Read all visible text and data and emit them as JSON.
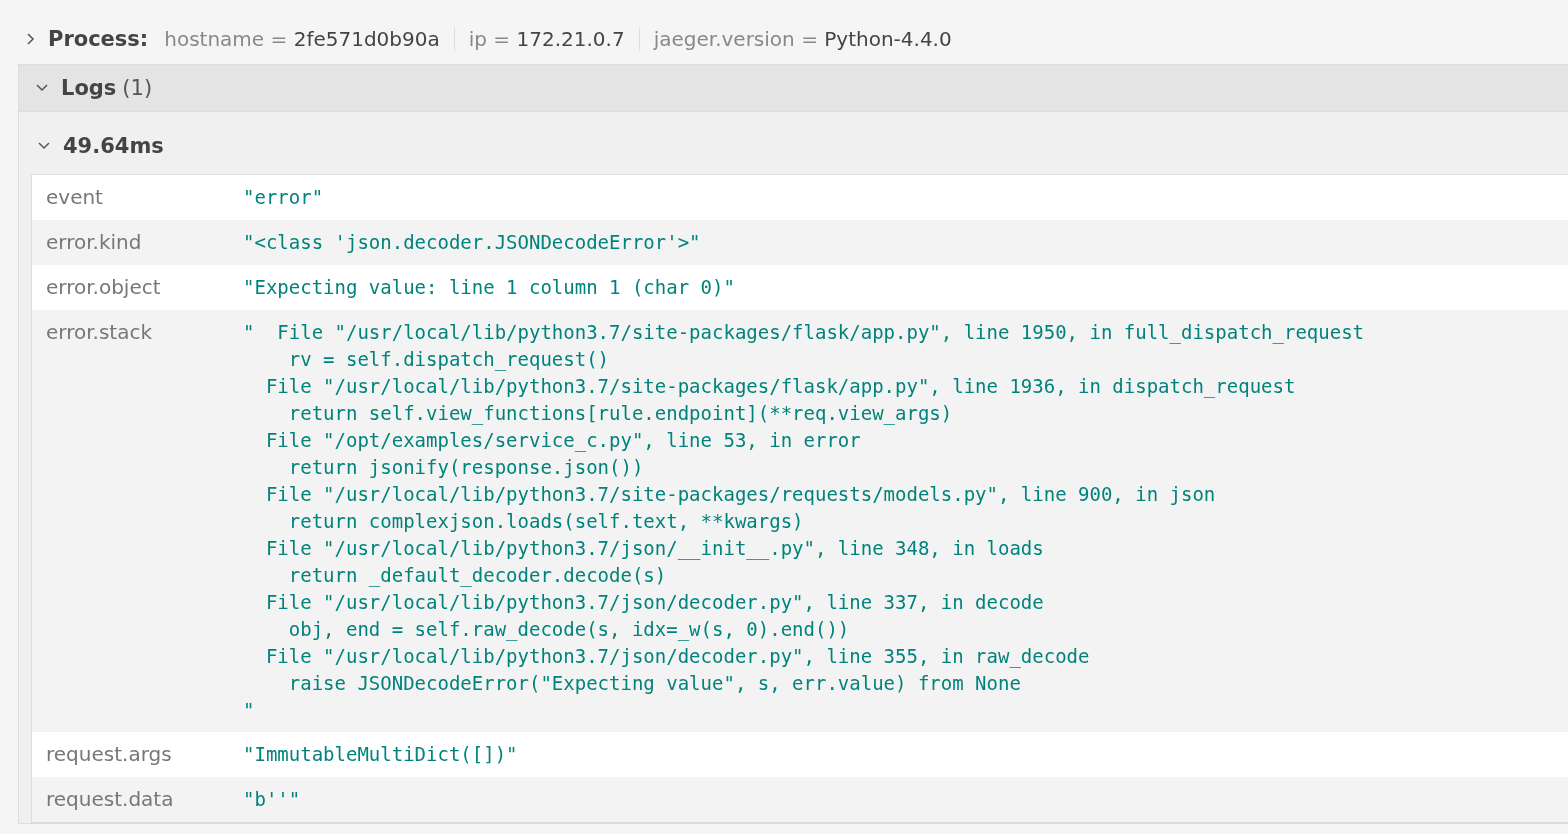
{
  "process": {
    "label": "Process:",
    "expanded": false,
    "tags": [
      {
        "key": "hostname",
        "sep": "=",
        "value": "2fe571d0b90a"
      },
      {
        "key": "ip",
        "sep": "=",
        "value": "172.21.0.7"
      },
      {
        "key": "jaeger.version",
        "sep": "=",
        "value": "Python-4.4.0"
      }
    ]
  },
  "logs": {
    "title": "Logs",
    "count": "(1)",
    "expanded": true,
    "entries": [
      {
        "time": "49.64ms",
        "expanded": true,
        "fields": [
          {
            "key": "event",
            "value": "\"error\""
          },
          {
            "key": "error.kind",
            "value": "\"<class 'json.decoder.JSONDecodeError'>\""
          },
          {
            "key": "error.object",
            "value": "\"Expecting value: line 1 column 1 (char 0)\""
          },
          {
            "key": "error.stack",
            "value": "\"  File \"/usr/local/lib/python3.7/site-packages/flask/app.py\", line 1950, in full_dispatch_request\n    rv = self.dispatch_request()\n  File \"/usr/local/lib/python3.7/site-packages/flask/app.py\", line 1936, in dispatch_request\n    return self.view_functions[rule.endpoint](**req.view_args)\n  File \"/opt/examples/service_c.py\", line 53, in error\n    return jsonify(response.json())\n  File \"/usr/local/lib/python3.7/site-packages/requests/models.py\", line 900, in json\n    return complexjson.loads(self.text, **kwargs)\n  File \"/usr/local/lib/python3.7/json/__init__.py\", line 348, in loads\n    return _default_decoder.decode(s)\n  File \"/usr/local/lib/python3.7/json/decoder.py\", line 337, in decode\n    obj, end = self.raw_decode(s, idx=_w(s, 0).end())\n  File \"/usr/local/lib/python3.7/json/decoder.py\", line 355, in raw_decode\n    raise JSONDecodeError(\"Expecting value\", s, err.value) from None\n\""
          },
          {
            "key": "request.args",
            "value": "\"ImmutableMultiDict([])\""
          },
          {
            "key": "request.data",
            "value": "\"b''\""
          }
        ]
      }
    ]
  }
}
